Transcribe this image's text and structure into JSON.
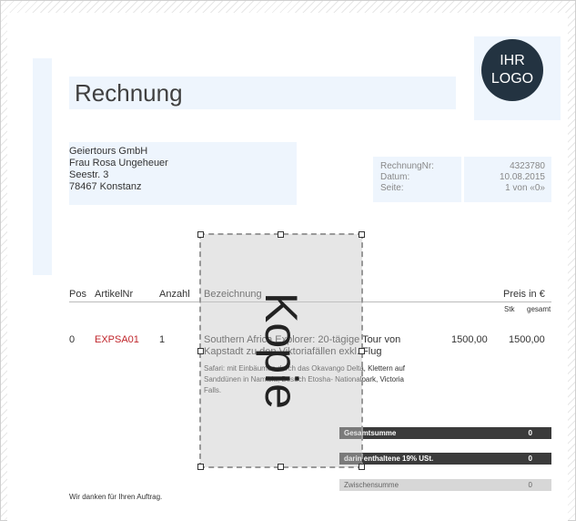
{
  "invoice": {
    "title": "Rechnung",
    "logo_line1": "IHR",
    "logo_line2": "LOGO",
    "recipient": {
      "company": "Geiertours GmbH",
      "name": "Frau Rosa Ungeheuer",
      "street": "Seestr. 3",
      "city": "78467 Konstanz"
    },
    "meta": {
      "labels": [
        "RechnungNr:",
        "Datum:",
        "Seite:"
      ],
      "values": [
        "4323780",
        "10.08.2015",
        "1 von «0»"
      ]
    },
    "table": {
      "headers": [
        "Pos",
        "ArtikelNr",
        "Anzahl",
        "Bezeichnung",
        "Preis in €"
      ],
      "subheaders": [
        "Stk",
        "gesamt"
      ],
      "row": {
        "pos": "0",
        "artikel": "EXPSA01",
        "anzahl": "1",
        "desc_line1": "Southern Africa Explorer: 20-tägige Tour von",
        "desc_line2": "Kapstadt zu den Viktoriafällen exkl. Flug",
        "detail1": "Safari: mit Einbäumen durch das Okavango Delta, Klettern auf",
        "detail2": "Sanddünen in Namibia, Besuch Etosha- Nationalpark, Victoria",
        "detail3": "Falls.",
        "price_stk": "1500,00",
        "price_total": "1500,00"
      }
    },
    "totals": {
      "gesamt_label": "Gesamtsumme",
      "gesamt_value": "0",
      "ust_label": "darin enthaltene 19% USt.",
      "ust_value": "0",
      "zwischen_label": "Zwischensumme",
      "zwischen_value": "0"
    },
    "thanks": "Wir danken für Ihren Auftrag."
  },
  "watermark": {
    "text": "Kopie"
  }
}
